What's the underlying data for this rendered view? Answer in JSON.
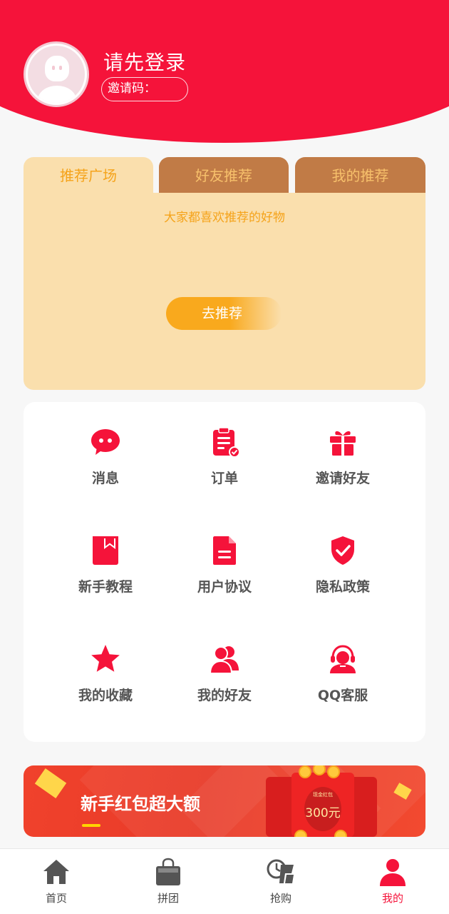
{
  "profile": {
    "login_prompt": "请先登录",
    "invite_label": "邀请码："
  },
  "recommend": {
    "tabs": [
      {
        "label": "推荐广场",
        "active": true
      },
      {
        "label": "好友推荐",
        "active": false
      },
      {
        "label": "我的推荐",
        "active": false
      }
    ],
    "hint": "大家都喜欢推荐的好物",
    "button_label": "去推荐"
  },
  "menu": {
    "items": [
      {
        "label": "消息",
        "icon": "chat-bubble-icon"
      },
      {
        "label": "订单",
        "icon": "clipboard-check-icon"
      },
      {
        "label": "邀请好友",
        "icon": "gift-icon"
      },
      {
        "label": "新手教程",
        "icon": "book-bookmark-icon"
      },
      {
        "label": "用户协议",
        "icon": "document-icon"
      },
      {
        "label": "隐私政策",
        "icon": "shield-check-icon"
      },
      {
        "label": "我的收藏",
        "icon": "star-icon"
      },
      {
        "label": "我的好友",
        "icon": "friends-icon"
      },
      {
        "label": "QQ客服",
        "icon": "headset-agent-icon"
      }
    ]
  },
  "banner": {
    "title": "新手红包超大额",
    "envelope_caption": "现金红包",
    "envelope_amount": "300元"
  },
  "tabbar": {
    "items": [
      {
        "label": "首页",
        "icon": "home-icon",
        "active": false
      },
      {
        "label": "拼团",
        "icon": "shopping-bag-icon",
        "active": false
      },
      {
        "label": "抢购",
        "icon": "flash-sale-icon",
        "active": false
      },
      {
        "label": "我的",
        "icon": "user-icon",
        "active": true
      }
    ]
  },
  "colors": {
    "brand_red": "#f5133a",
    "tab_active_bg": "#fadfad",
    "tab_inactive_bg": "#c17b46",
    "accent_orange": "#f5a31a",
    "menu_label": "#555555"
  }
}
